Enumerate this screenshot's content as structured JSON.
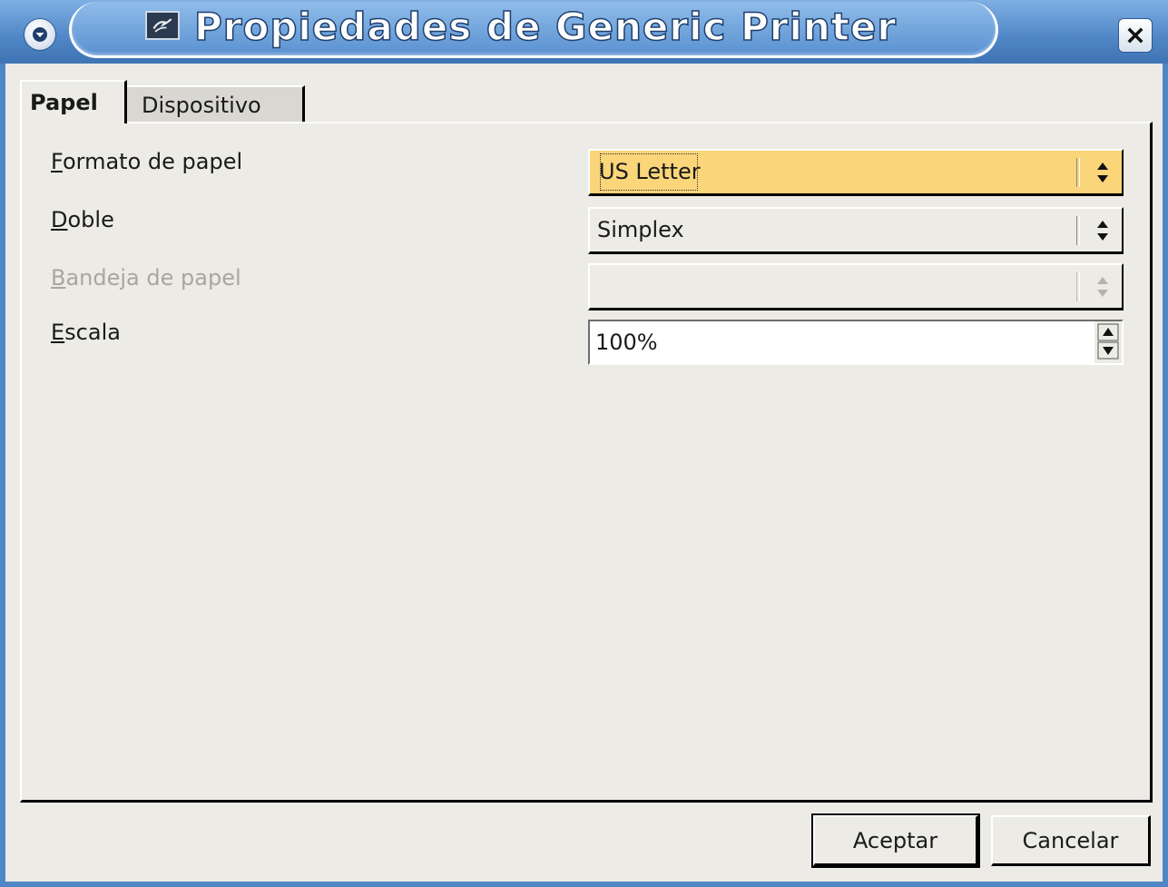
{
  "window": {
    "title": "Propiedades de Generic Printer",
    "icons": {
      "menu": "chevron-down-icon",
      "app": "printer-app-icon",
      "close": "close-icon"
    }
  },
  "tabs": [
    {
      "label": "Papel",
      "active": true
    },
    {
      "label": "Dispositivo",
      "active": false
    }
  ],
  "form": {
    "paper_format": {
      "label": "Formato de papel",
      "mnemonic": "F",
      "value": "US Letter",
      "focused": true
    },
    "duplex": {
      "label": "Doble",
      "mnemonic": "D",
      "value": "Simplex"
    },
    "paper_tray": {
      "label": "Bandeja de papel",
      "mnemonic": "B",
      "value": "",
      "disabled": true
    },
    "scale": {
      "label": "Escala",
      "mnemonic": "E",
      "value": "100%"
    }
  },
  "buttons": {
    "ok": "Aceptar",
    "cancel": "Cancelar"
  },
  "colors": {
    "titlebar": "#4f86c6",
    "focus_highlight": "#fbd579",
    "background": "#ecebe6"
  }
}
